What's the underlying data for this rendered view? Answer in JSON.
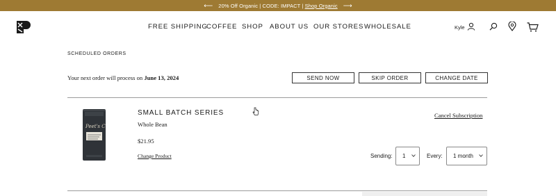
{
  "promo": {
    "text": "20% Off Organic | CODE: IMPACT | ",
    "link_label": "Shop Organic",
    "left_arrow": "⟵",
    "right_arrow": "⟶"
  },
  "header": {
    "logo_icon": "brand-logo-icon",
    "nav": [
      {
        "label": "FREE SHIPPING"
      },
      {
        "label": "COFFEE"
      },
      {
        "label": "SHOP"
      },
      {
        "label": "ABOUT US"
      },
      {
        "label": "OUR STORES"
      },
      {
        "label": "WHOLESALE"
      }
    ],
    "user_name": "Kyle",
    "icons": [
      "user-icon",
      "search-icon",
      "location-pin-icon",
      "cart-icon"
    ]
  },
  "page": {
    "section_title": "SCHEDULED ORDERS",
    "next_order_prefix": "Your next order will process on ",
    "next_order_date": "June 13, 2024",
    "buttons": {
      "send_now": "SEND NOW",
      "skip_order": "SKIP ORDER",
      "change_date": "CHANGE DATE"
    }
  },
  "subscription": {
    "product_name": "SMALL BATCH SERIES",
    "grind": "Whole Bean",
    "price": "$21.95",
    "change_product_label": "Change Product",
    "cancel_label": "Cancel Subscription",
    "sending_label": "Sending:",
    "sending_value": "1",
    "every_label": "Every:",
    "every_value": "1 month"
  },
  "colors": {
    "promo_bar": "#9e7a33",
    "text": "#1a1a1a",
    "divider": "#9a9a9a"
  }
}
